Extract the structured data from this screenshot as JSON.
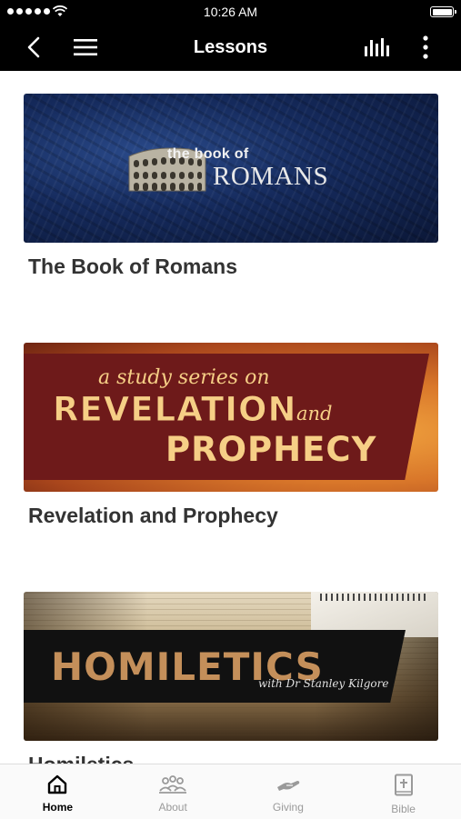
{
  "status_bar": {
    "time": "10:26 AM"
  },
  "nav": {
    "title": "Lessons"
  },
  "lessons": [
    {
      "title": "The Book of Romans",
      "banner_line1": "the book of",
      "banner_line2": "ROMANS"
    },
    {
      "title": "Revelation and Prophecy",
      "banner_line1": "a study series on",
      "banner_line2": "REVELATION",
      "banner_line3": "and",
      "banner_line4": "PROPHECY"
    },
    {
      "title": "Homiletics",
      "banner_line1": "HOMILETICS",
      "banner_line2": "with Dr Stanley Kilgore"
    }
  ],
  "tabs": [
    {
      "label": "Home",
      "icon": "home-icon",
      "active": true
    },
    {
      "label": "About",
      "icon": "people-icon",
      "active": false
    },
    {
      "label": "Giving",
      "icon": "hand-giving-icon",
      "active": false
    },
    {
      "label": "Bible",
      "icon": "bible-icon",
      "active": false
    }
  ],
  "colors": {
    "bar_background": "#000000",
    "active_tab": "#000000",
    "inactive_tab": "#9a9a9a",
    "title_text": "#333333"
  }
}
